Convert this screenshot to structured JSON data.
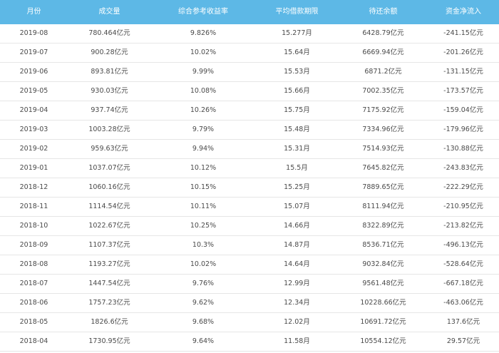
{
  "table": {
    "headers": [
      "月份",
      "成交量",
      "综合参考收益率",
      "平均借款期限",
      "待还余额",
      "资金净流入"
    ],
    "rows": [
      [
        "2019-08",
        "780.464亿元",
        "9.826%",
        "15.277月",
        "6428.79亿元",
        "-241.15亿元"
      ],
      [
        "2019-07",
        "900.28亿元",
        "10.02%",
        "15.64月",
        "6669.94亿元",
        "-201.26亿元"
      ],
      [
        "2019-06",
        "893.81亿元",
        "9.99%",
        "15.53月",
        "6871.2亿元",
        "-131.15亿元"
      ],
      [
        "2019-05",
        "930.03亿元",
        "10.08%",
        "15.66月",
        "7002.35亿元",
        "-173.57亿元"
      ],
      [
        "2019-04",
        "937.74亿元",
        "10.26%",
        "15.75月",
        "7175.92亿元",
        "-159.04亿元"
      ],
      [
        "2019-03",
        "1003.28亿元",
        "9.79%",
        "15.48月",
        "7334.96亿元",
        "-179.96亿元"
      ],
      [
        "2019-02",
        "959.63亿元",
        "9.94%",
        "15.31月",
        "7514.93亿元",
        "-130.88亿元"
      ],
      [
        "2019-01",
        "1037.07亿元",
        "10.12%",
        "15.5月",
        "7645.82亿元",
        "-243.83亿元"
      ],
      [
        "2018-12",
        "1060.16亿元",
        "10.15%",
        "15.25月",
        "7889.65亿元",
        "-222.29亿元"
      ],
      [
        "2018-11",
        "1114.54亿元",
        "10.11%",
        "15.07月",
        "8111.94亿元",
        "-210.95亿元"
      ],
      [
        "2018-10",
        "1022.67亿元",
        "10.25%",
        "14.66月",
        "8322.89亿元",
        "-213.82亿元"
      ],
      [
        "2018-09",
        "1107.37亿元",
        "10.3%",
        "14.87月",
        "8536.71亿元",
        "-496.13亿元"
      ],
      [
        "2018-08",
        "1193.27亿元",
        "10.02%",
        "14.64月",
        "9032.84亿元",
        "-528.64亿元"
      ],
      [
        "2018-07",
        "1447.54亿元",
        "9.76%",
        "12.99月",
        "9561.48亿元",
        "-667.18亿元"
      ],
      [
        "2018-06",
        "1757.23亿元",
        "9.62%",
        "12.34月",
        "10228.66亿元",
        "-463.06亿元"
      ],
      [
        "2018-05",
        "1826.6亿元",
        "9.68%",
        "12.02月",
        "10691.72亿元",
        "137.6亿元"
      ],
      [
        "2018-04",
        "1730.95亿元",
        "9.64%",
        "11.58月",
        "10554.12亿元",
        "29.57亿元"
      ]
    ]
  }
}
